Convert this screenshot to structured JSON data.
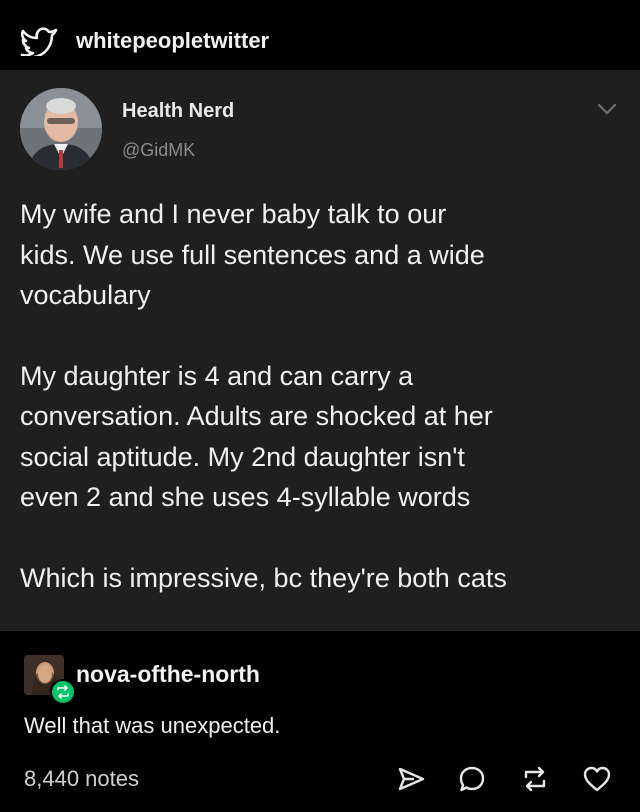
{
  "header": {
    "source_name": "whitepeopletwitter",
    "icon": "twitter-bird-icon"
  },
  "tweet": {
    "author_name": "Health Nerd",
    "author_handle": "@GidMK",
    "paragraphs": [
      "My wife and I never baby talk to our kids. We use full sentences and a wide vocabulary",
      "My daughter is 4 and can carry a conversation. Adults are shocked at her social aptitude. My 2nd daughter isn't even 2 and she uses 4-syllable words",
      "Which is impressive, bc they're both cats"
    ],
    "lines": [
      [
        "My wife and I never baby talk to our",
        "kids. We use full sentences and a wide",
        "vocabulary"
      ],
      [
        "My daughter is 4 and can carry a",
        "conversation. Adults are shocked at her",
        "social aptitude. My 2nd daughter isn't",
        "even 2 and she uses 4-syllable words"
      ],
      [
        "Which is impressive, bc they're both cats"
      ]
    ]
  },
  "reblog": {
    "username": "nova-ofthe-north",
    "comment": "Well that was unexpected.",
    "badge_color": "#00c46a"
  },
  "footer": {
    "notes": "8,440 notes",
    "actions": [
      "share-icon",
      "reply-icon",
      "reblog-icon",
      "like-icon"
    ]
  },
  "colors": {
    "background": "#000000",
    "tweet_card": "#1f1f1f",
    "text": "#f0f0f0",
    "muted": "#8b8b8b"
  }
}
